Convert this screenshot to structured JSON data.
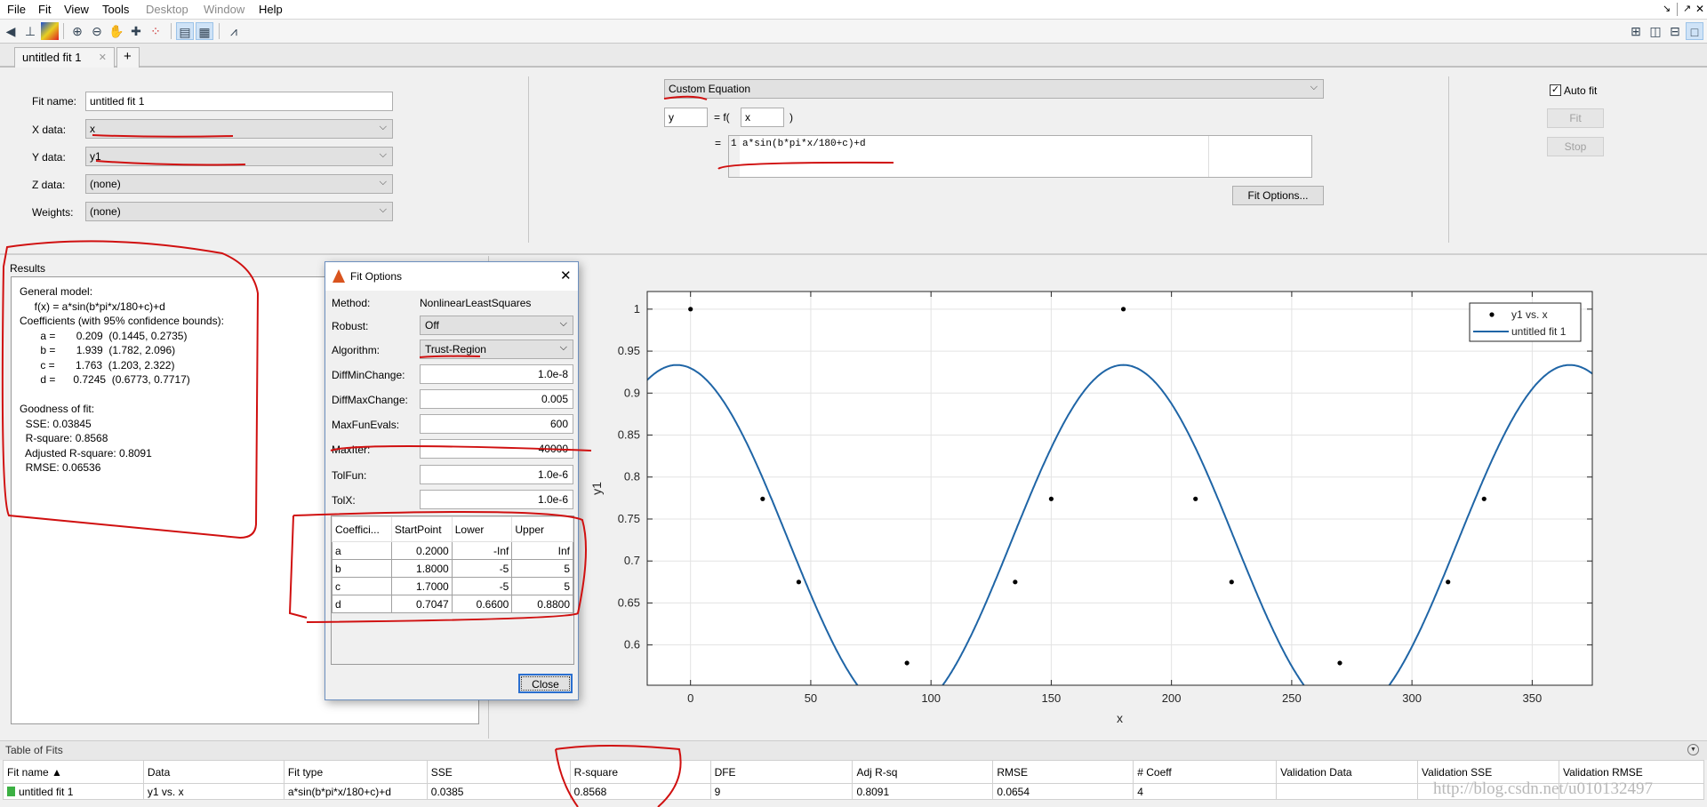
{
  "menu": [
    "File",
    "Fit",
    "View",
    "Tools",
    "Desktop",
    "Window",
    "Help"
  ],
  "menu_disabled": [
    "Desktop",
    "Window"
  ],
  "window_controls": {
    "undock": "↘",
    "dock": "↗",
    "close": "✕"
  },
  "tabs": [
    {
      "label": "untitled fit 1"
    }
  ],
  "data_panel": {
    "fit_name_label": "Fit name:",
    "fit_name_value": "untitled fit 1",
    "x_label": "X data:",
    "x_value": "x",
    "y_label": "Y data:",
    "y_value": "y1",
    "z_label": "Z data:",
    "z_value": "(none)",
    "weights_label": "Weights:",
    "weights_value": "(none)"
  },
  "equation_panel": {
    "fit_type": "Custom Equation",
    "dependent": "y",
    "equals_f": "= f(",
    "independent": "x",
    "close_paren": ")",
    "equals": "=",
    "line_number": "1",
    "equation": "a*sin(b*pi*x/180+c)+d",
    "fit_options_button": "Fit Options..."
  },
  "auto_panel": {
    "auto_fit_label": "Auto fit",
    "auto_fit_checked": true,
    "fit_button": "Fit",
    "stop_button": "Stop"
  },
  "results": {
    "title": "Results",
    "text": "General model:\n     f(x) = a*sin(b*pi*x/180+c)+d\nCoefficients (with 95% confidence bounds):\n       a =       0.209  (0.1445, 0.2735)\n       b =       1.939  (1.782, 2.096)\n       c =       1.763  (1.203, 2.322)\n       d =      0.7245  (0.6773, 0.7717)\n\nGoodness of fit:\n  SSE: 0.03845\n  R-square: 0.8568\n  Adjusted R-square: 0.8091\n  RMSE: 0.06536"
  },
  "fit_options": {
    "title": "Fit Options",
    "method_label": "Method:",
    "method_value": "NonlinearLeastSquares",
    "robust_label": "Robust:",
    "robust_value": "Off",
    "algorithm_label": "Algorithm:",
    "algorithm_value": "Trust-Region",
    "fields": [
      {
        "label": "DiffMinChange:",
        "value": "1.0e-8"
      },
      {
        "label": "DiffMaxChange:",
        "value": "0.005"
      },
      {
        "label": "MaxFunEvals:",
        "value": "600"
      },
      {
        "label": "MaxIter:",
        "value": "40000"
      },
      {
        "label": "TolFun:",
        "value": "1.0e-6"
      },
      {
        "label": "TolX:",
        "value": "1.0e-6"
      }
    ],
    "coef_headers": [
      "Coeffici...",
      "StartPoint",
      "Lower",
      "Upper"
    ],
    "coef_rows": [
      [
        "a",
        "0.2000",
        "-Inf",
        "Inf"
      ],
      [
        "b",
        "1.8000",
        "-5",
        "5"
      ],
      [
        "c",
        "1.7000",
        "-5",
        "5"
      ],
      [
        "d",
        "0.7047",
        "0.6600",
        "0.8800"
      ]
    ],
    "close_button": "Close"
  },
  "table_of_fits": {
    "title": "Table of Fits",
    "headers": [
      "Fit name ▲",
      "Data",
      "Fit type",
      "SSE",
      "R-square",
      "DFE",
      "Adj R-sq",
      "RMSE",
      "# Coeff",
      "Validation Data",
      "Validation SSE",
      "Validation RMSE"
    ],
    "rows": [
      [
        "untitled fit 1",
        "y1 vs. x",
        "a*sin(b*pi*x/180+c)+d",
        "0.0385",
        "0.8568",
        "9",
        "0.8091",
        "0.0654",
        "4",
        "",
        "",
        ""
      ]
    ],
    "status_color": "#3cb043"
  },
  "watermark": "http://blog.csdn.net/u010132497",
  "chart_data": {
    "type": "scatter",
    "xlabel": "x",
    "ylabel": "y1",
    "xlim": [
      -18,
      375
    ],
    "ylim": [
      0.552,
      1.021
    ],
    "xticks": [
      0,
      50,
      100,
      150,
      200,
      250,
      300,
      350
    ],
    "yticks": [
      0.6,
      0.65,
      0.7,
      0.75,
      0.8,
      0.85,
      0.9,
      0.95,
      1
    ],
    "grid": true,
    "legend_placement": "top-right",
    "series": [
      {
        "name": "y1 vs. x",
        "kind": "points",
        "color": "#000000",
        "x": [
          0,
          30,
          45,
          90,
          135,
          150,
          180,
          210,
          225,
          270,
          315,
          330
        ],
        "y": [
          1,
          0.774,
          0.675,
          0.5785,
          0.675,
          0.774,
          1,
          0.774,
          0.675,
          0.5785,
          0.675,
          0.774
        ]
      },
      {
        "name": "untitled fit 1",
        "kind": "line",
        "color": "#1f65a6",
        "model": "a*sin(b*pi*x/180+c)+d",
        "coefficients": {
          "a": 0.209,
          "b": 1.939,
          "c": 1.763,
          "d": 0.7245
        }
      }
    ]
  }
}
